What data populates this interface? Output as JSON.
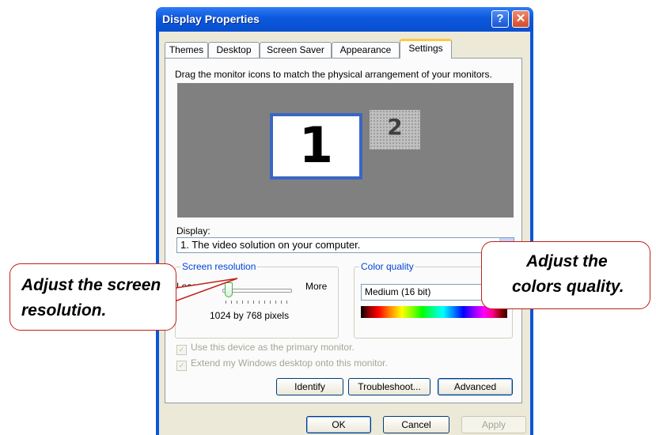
{
  "window": {
    "title": "Display Properties",
    "help_label": "?",
    "close_label": "✕"
  },
  "tabs": [
    "Themes",
    "Desktop",
    "Screen Saver",
    "Appearance",
    "Settings"
  ],
  "active_tab": "Settings",
  "settings": {
    "instruction": "Drag the monitor icons to match the physical arrangement of your monitors.",
    "monitors": [
      "1",
      "2"
    ],
    "display_label": "Display:",
    "display_value": "1. The video solution on your computer.",
    "screen_resolution": {
      "title": "Screen resolution",
      "less": "Less",
      "more": "More",
      "value": "1024 by 768 pixels"
    },
    "color_quality": {
      "title": "Color quality",
      "value": "Medium (16 bit)"
    },
    "checkboxes": [
      {
        "label": "Use this device as the primary monitor.",
        "checked": true
      },
      {
        "label": "Extend my Windows desktop onto this monitor.",
        "checked": true
      }
    ],
    "buttons": {
      "identify": "Identify",
      "troubleshoot": "Troubleshoot...",
      "advanced": "Advanced"
    }
  },
  "dialog_buttons": {
    "ok": "OK",
    "cancel": "Cancel",
    "apply": "Apply"
  },
  "callouts": {
    "left": [
      "Adjust the screen",
      "resolution."
    ],
    "right": [
      "Adjust the",
      "colors quality."
    ]
  },
  "colors": {
    "titlebar": "#0b58dc",
    "panel": "#ece9d8",
    "group_title": "#0046d5",
    "callout_border": "#c0201a",
    "monitor_border": "#3a66c4"
  }
}
